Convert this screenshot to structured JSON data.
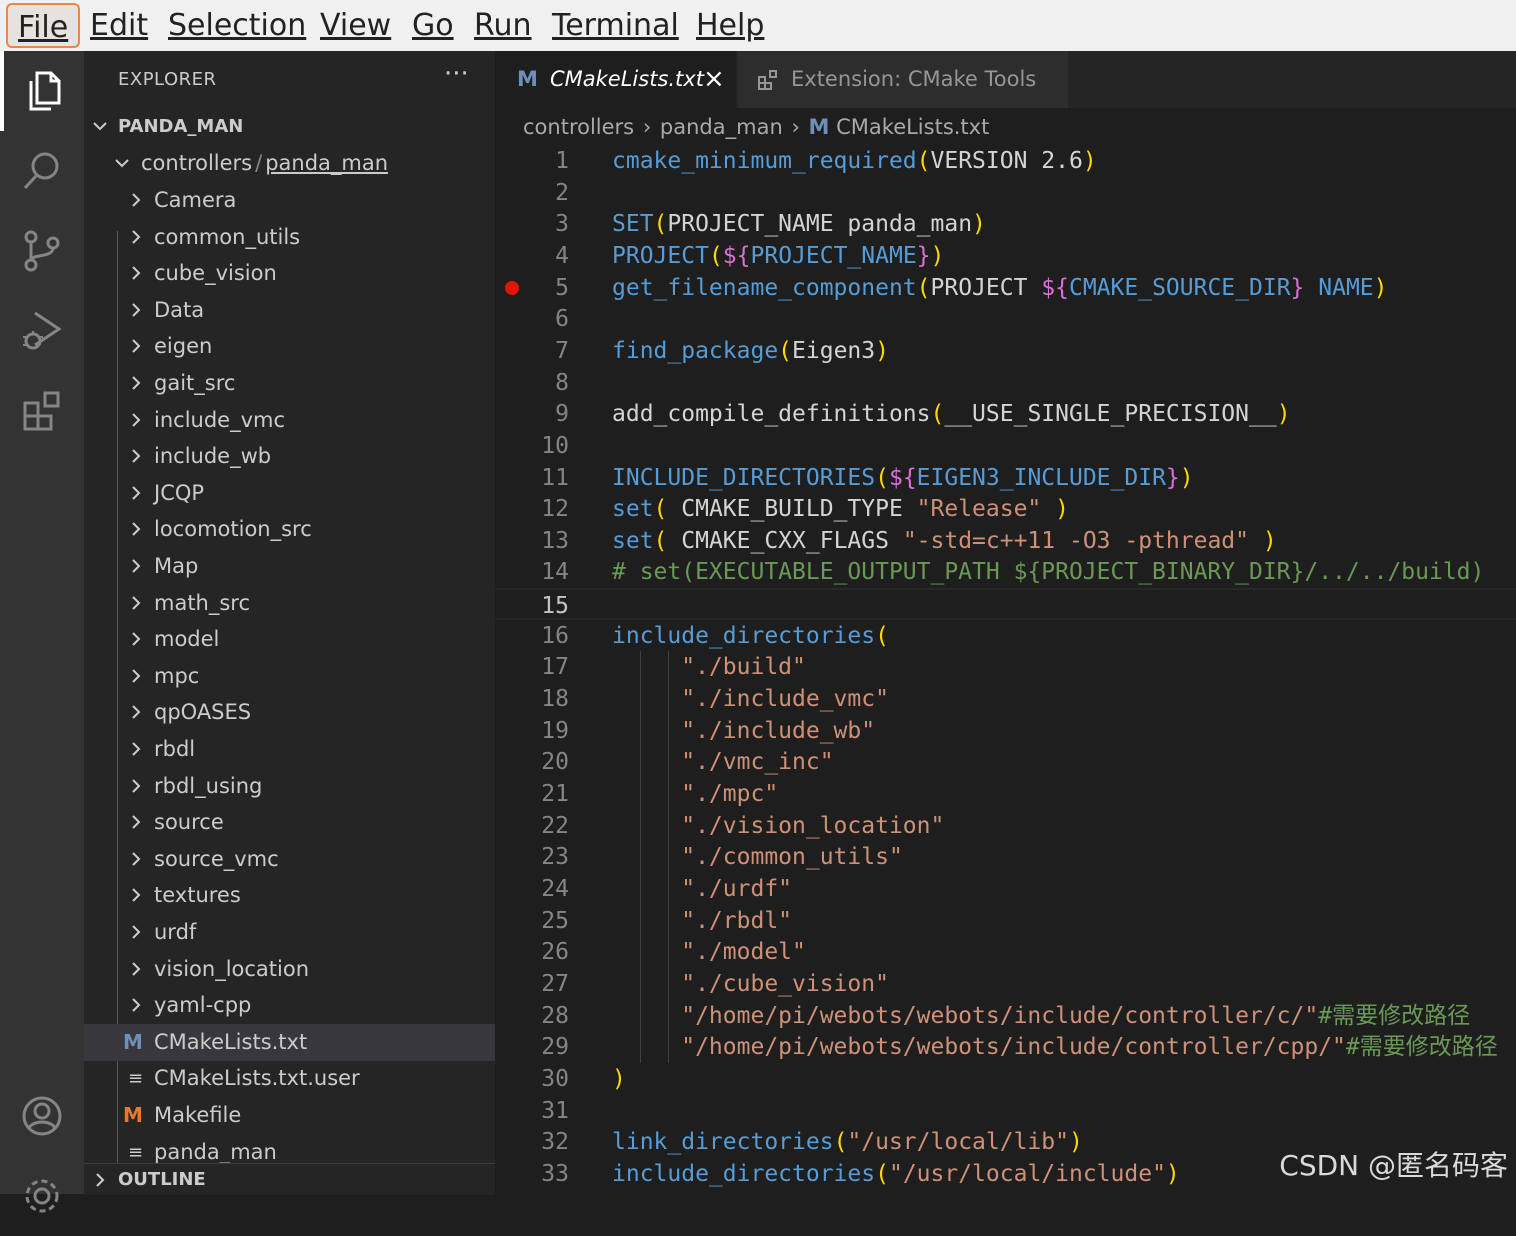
{
  "menu": {
    "file": "File",
    "edit": "Edit",
    "selection": "Selection",
    "view": "View",
    "go": "Go",
    "run": "Run",
    "terminal": "Terminal",
    "help": "Help"
  },
  "explorer": {
    "title": "EXPLORER",
    "more": "···",
    "root": "PANDA_MAN",
    "folder_path_1": "controllers",
    "folder_path_sep": "/",
    "folder_path_2": "panda_man",
    "folders": [
      "Camera",
      "common_utils",
      "cube_vision",
      "Data",
      "eigen",
      "gait_src",
      "include_vmc",
      "include_wb",
      "JCQP",
      "locomotion_src",
      "Map",
      "math_src",
      "model",
      "mpc",
      "qpOASES",
      "rbdl",
      "rbdl_using",
      "source",
      "source_vmc",
      "textures",
      "urdf",
      "vision_location",
      "yaml-cpp"
    ],
    "files": [
      {
        "name": "CMakeLists.txt",
        "icon": "cmake-icon"
      },
      {
        "name": "CMakeLists.txt.user",
        "icon": "lines-icon"
      },
      {
        "name": "Makefile",
        "icon": "makefile-icon"
      },
      {
        "name": "panda_man",
        "icon": "lines-icon"
      }
    ],
    "outline": "OUTLINE"
  },
  "tabs": [
    {
      "label": "CMakeLists.txt",
      "icon": "cmake-icon",
      "close": "×"
    },
    {
      "label": "Extension: CMake Tools",
      "icon": "extension-icon"
    }
  ],
  "breadcrumb": {
    "part1": "controllers",
    "part2": "panda_man",
    "part3": "CMakeLists.txt",
    "sep": "›"
  },
  "colors": {
    "keyword": "#569cd6",
    "string": "#ce9178",
    "comment": "#6a9955",
    "variable": "#4fc1ff",
    "paren": "#ffd700",
    "brace": "#da70d6",
    "text": "#d4d4d4",
    "accent": "#e9874a",
    "breakpoint": "#e51400"
  },
  "editor": {
    "current_line": 15,
    "breakpoint_line": 5,
    "lines": [
      [
        [
          "cmake_minimum_required",
          "k"
        ],
        [
          "(",
          "p"
        ],
        [
          "VERSION 2.6",
          ""
        ],
        [
          ")",
          "p"
        ]
      ],
      [],
      [
        [
          "SET",
          "k"
        ],
        [
          "(",
          "p"
        ],
        [
          "PROJECT_NAME panda_man",
          ""
        ],
        [
          ")",
          "p"
        ]
      ],
      [
        [
          "PROJECT",
          "k"
        ],
        [
          "(",
          "p"
        ],
        [
          "${",
          "b"
        ],
        [
          "PROJECT_NAME",
          "k"
        ],
        [
          "}",
          "b"
        ],
        [
          ")",
          "p"
        ]
      ],
      [
        [
          "get_filename_component",
          "k"
        ],
        [
          "(",
          "p"
        ],
        [
          "PROJECT ",
          ""
        ],
        [
          "${",
          "b"
        ],
        [
          "CMAKE_SOURCE_DIR",
          "k"
        ],
        [
          "}",
          "b"
        ],
        [
          " ",
          ""
        ],
        [
          "NAME",
          "k"
        ],
        [
          ")",
          "p"
        ]
      ],
      [],
      [
        [
          "find_package",
          "k"
        ],
        [
          "(",
          "p"
        ],
        [
          "Eigen3",
          ""
        ],
        [
          ")",
          "p"
        ]
      ],
      [],
      [
        [
          "add_compile_definitions",
          ""
        ],
        [
          "(",
          "p"
        ],
        [
          "__USE_SINGLE_PRECISION__",
          ""
        ],
        [
          ")",
          "p"
        ]
      ],
      [],
      [
        [
          "INCLUDE_DIRECTORIES",
          "k"
        ],
        [
          "(",
          "p"
        ],
        [
          "${",
          "b"
        ],
        [
          "EIGEN3_INCLUDE_DIR",
          "k"
        ],
        [
          "}",
          "b"
        ],
        [
          ")",
          "p"
        ]
      ],
      [
        [
          "set",
          "k"
        ],
        [
          "( ",
          "p"
        ],
        [
          "CMAKE_BUILD_TYPE ",
          ""
        ],
        [
          "\"Release\"",
          "s"
        ],
        [
          " )",
          "p"
        ]
      ],
      [
        [
          "set",
          "k"
        ],
        [
          "( ",
          "p"
        ],
        [
          "CMAKE_CXX_FLAGS ",
          ""
        ],
        [
          "\"-std=c++11 -O3 -pthread\"",
          "s"
        ],
        [
          " )",
          "p"
        ]
      ],
      [
        [
          "# set(EXECUTABLE_OUTPUT_PATH ${PROJECT_BINARY_DIR}/../../build)",
          "c"
        ]
      ],
      [],
      [
        [
          "include_directories",
          "k"
        ],
        [
          "(",
          "p"
        ]
      ],
      [
        [
          "     \"./build\"",
          "s"
        ]
      ],
      [
        [
          "     \"./include_vmc\"",
          "s"
        ]
      ],
      [
        [
          "     \"./include_wb\"",
          "s"
        ]
      ],
      [
        [
          "     \"./vmc_inc\"",
          "s"
        ]
      ],
      [
        [
          "     \"./mpc\"",
          "s"
        ]
      ],
      [
        [
          "     \"./vision_location\"",
          "s"
        ]
      ],
      [
        [
          "     \"./common_utils\"",
          "s"
        ]
      ],
      [
        [
          "     \"./urdf\"",
          "s"
        ]
      ],
      [
        [
          "     \"./rbdl\"",
          "s"
        ]
      ],
      [
        [
          "     \"./model\"",
          "s"
        ]
      ],
      [
        [
          "     \"./cube_vision\"",
          "s"
        ]
      ],
      [
        [
          "     \"/home/pi/webots/webots/include/controller/c/\"",
          "s"
        ],
        [
          "#需要修改路径",
          "c"
        ]
      ],
      [
        [
          "     \"/home/pi/webots/webots/include/controller/cpp/\"",
          "s"
        ],
        [
          "#需要修改路径",
          "c"
        ]
      ],
      [
        [
          ")",
          "p"
        ]
      ],
      [],
      [
        [
          "link_directories",
          "k"
        ],
        [
          "(",
          "p"
        ],
        [
          "\"/usr/local/lib\"",
          "s"
        ],
        [
          ")",
          "p"
        ]
      ],
      [
        [
          "include_directories",
          "k"
        ],
        [
          "(",
          "p"
        ],
        [
          "\"/usr/local/include\"",
          "s"
        ],
        [
          ")",
          "p"
        ]
      ]
    ]
  },
  "watermark": "CSDN @匿名码客"
}
